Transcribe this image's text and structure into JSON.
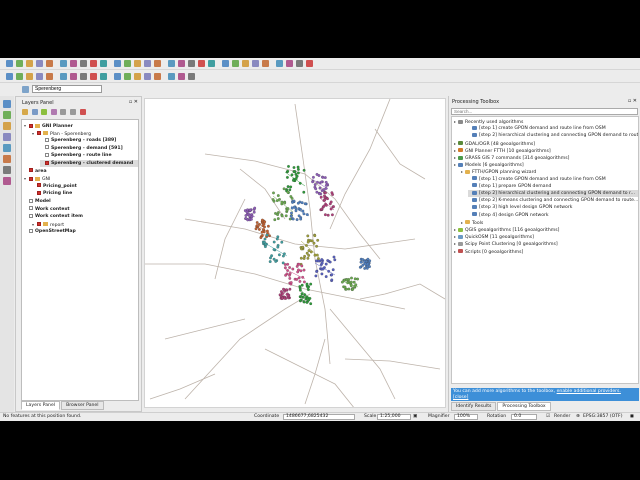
{
  "toolbar": {
    "row1_icons": [
      "new-project-icon",
      "open-project-icon",
      "save-project-icon",
      "save-as-icon",
      "print-icon",
      "style-manager-icon",
      "pan-icon",
      "pan-to-selection-icon",
      "zoom-in-icon",
      "zoom-out-icon",
      "zoom-full-icon",
      "zoom-layer-icon",
      "zoom-selection-icon",
      "zoom-last-icon",
      "zoom-next-icon",
      "new-bookmark-icon",
      "refresh-icon",
      "identify-icon",
      "select-icon",
      "deselect-icon",
      "open-table-icon",
      "field-calc-icon",
      "statistics-icon",
      "sum-icon",
      "measure-icon",
      "map-tips-icon",
      "annotation-icon",
      "label-icon",
      "help-icon"
    ],
    "row2_icons": [
      "edit-pencil-icon",
      "digitize-icon",
      "node-tool-icon",
      "add-feature-icon",
      "move-feature-icon",
      "delete-icon",
      "cut-icon",
      "copy-icon",
      "paste-icon",
      "undo-icon",
      "redo-icon",
      "label-pin-icon",
      "label-show-icon",
      "label-move-icon",
      "label-rotate-icon",
      "plugin-icon",
      "python-icon",
      "gpon-icon"
    ]
  },
  "locator": {
    "value": "Sperenberg"
  },
  "layers_panel": {
    "title": "Layers Panel",
    "tabs": [
      "Layers Panel",
      "Browser Panel"
    ],
    "items": [
      {
        "label": "GNI Planner",
        "depth": 0,
        "type": "group",
        "checked": true,
        "bold": true
      },
      {
        "label": "Plan - Sperenberg",
        "depth": 1,
        "type": "group",
        "checked": true,
        "bold": false
      },
      {
        "label": "Sperenberg - roads [389]",
        "depth": 2,
        "type": "layer",
        "checked": false,
        "bold": true
      },
      {
        "label": "Sperenberg - demand [591]",
        "depth": 2,
        "type": "layer",
        "checked": false,
        "bold": true
      },
      {
        "label": "Sperenberg - route line",
        "depth": 2,
        "type": "layer",
        "checked": false,
        "bold": true
      },
      {
        "label": "Sperenberg - clustered demand",
        "depth": 2,
        "type": "layer",
        "checked": true,
        "bold": true,
        "selected": true
      },
      {
        "label": "area",
        "depth": 0,
        "type": "layer",
        "checked": true,
        "bold": true
      },
      {
        "label": "GNI",
        "depth": 0,
        "type": "group",
        "checked": true,
        "bold": false
      },
      {
        "label": "Pricing_point",
        "depth": 1,
        "type": "layer",
        "checked": true,
        "bold": true
      },
      {
        "label": "Pricing line",
        "depth": 1,
        "type": "layer",
        "checked": true,
        "bold": true
      },
      {
        "label": "Model",
        "depth": 0,
        "type": "layer",
        "checked": false,
        "bold": true
      },
      {
        "label": "Work context",
        "depth": 0,
        "type": "layer",
        "checked": false,
        "bold": true
      },
      {
        "label": "Work context item",
        "depth": 0,
        "type": "layer",
        "checked": false,
        "bold": true
      },
      {
        "label": "report",
        "depth": 1,
        "type": "group",
        "checked": true,
        "bold": false
      },
      {
        "label": "OpenStreetMap",
        "depth": 0,
        "type": "layer",
        "checked": false,
        "bold": true
      }
    ]
  },
  "processing": {
    "title": "Processing Toolbox",
    "search_placeholder": "Search...",
    "items": [
      {
        "label": "Recently used algorithms",
        "depth": 0,
        "icon": "clock-icon",
        "color": "#8a8a8a"
      },
      {
        "label": "[step 1] create GPON demand and route line from OSM",
        "depth": 2,
        "icon": "model-icon",
        "color": "#5580b8"
      },
      {
        "label": "[step 2] hierarchical clustering and connecting GPON demand to rout...",
        "depth": 2,
        "icon": "model-icon",
        "color": "#5580b8"
      },
      {
        "label": "GDAL/OGR [48 geoalgorithms]",
        "depth": 0,
        "icon": "gdal-icon",
        "color": "#5a8a3a"
      },
      {
        "label": "GNI Planner FTTH [10 geoalgorithms]",
        "depth": 0,
        "icon": "gni-icon",
        "color": "#d07a2a"
      },
      {
        "label": "GRASS GIS 7 commands [314 geoalgorithms]",
        "depth": 0,
        "icon": "grass-icon",
        "color": "#4a9a4a"
      },
      {
        "label": "Models [6 geoalgorithms]",
        "depth": 0,
        "icon": "models-icon",
        "color": "#5580b8"
      },
      {
        "label": "FTTH/GPON planning wizard",
        "depth": 1,
        "icon": "folder-icon",
        "color": "#e3b14d"
      },
      {
        "label": "[step 1] create GPON demand and route line from OSM",
        "depth": 2,
        "icon": "model-icon",
        "color": "#5580b8"
      },
      {
        "label": "[step 1] prepare GPON demand",
        "depth": 2,
        "icon": "model-icon",
        "color": "#5580b8"
      },
      {
        "label": "[step 2] hierarchical clustering and connecting GPON demand to r...",
        "depth": 2,
        "icon": "model-icon",
        "color": "#5580b8",
        "selected": true
      },
      {
        "label": "[step 2] K-means clustering and connecting GPON demand to route...",
        "depth": 2,
        "icon": "model-icon",
        "color": "#5580b8"
      },
      {
        "label": "[step 3] high level design GPON network",
        "depth": 2,
        "icon": "model-icon",
        "color": "#5580b8"
      },
      {
        "label": "[step 4] design GPON network",
        "depth": 2,
        "icon": "model-icon",
        "color": "#5580b8"
      },
      {
        "label": "Tools",
        "depth": 1,
        "icon": "folder-icon",
        "color": "#e3b14d"
      },
      {
        "label": "QGIS geoalgorithms [116 geoalgorithms]",
        "depth": 0,
        "icon": "qgis-icon",
        "color": "#8cbf3f"
      },
      {
        "label": "QuickOSM [11 geoalgorithms]",
        "depth": 0,
        "icon": "osm-icon",
        "color": "#6b9ac4"
      },
      {
        "label": "Scipy Point Clustering [0 geoalgorithms]",
        "depth": 0,
        "icon": "scipy-icon",
        "color": "#999999"
      },
      {
        "label": "Scripts [0 geoalgorithms]",
        "depth": 0,
        "icon": "scripts-icon",
        "color": "#c05050"
      }
    ],
    "info_text": "You can add more algorithms to the toolbox,",
    "info_link1": "enable additional providers.",
    "info_link2": "[close]",
    "tabs": [
      "Identify Results",
      "Processing Toolbox"
    ]
  },
  "status": {
    "message": "No features at this position found.",
    "coordinate_label": "Coordinate",
    "coordinate_value": "1486677,6825432",
    "scale_label": "Scale",
    "scale_value": "1:25,000",
    "magnifier_label": "Magnifier",
    "magnifier_value": "100%",
    "rotation_label": "Rotation",
    "rotation_value": "0.0",
    "render_label": "Render",
    "crs_label": "EPSG:3857 (OTF)"
  },
  "map": {
    "cluster_colors": [
      "#2e9a3a",
      "#6aa84f",
      "#4f7fbf",
      "#8e5db8",
      "#b0407a",
      "#c06030",
      "#3f9ea0",
      "#9e9e3a",
      "#d0508a",
      "#5860c0"
    ],
    "road_color": "#bdb3aa"
  }
}
